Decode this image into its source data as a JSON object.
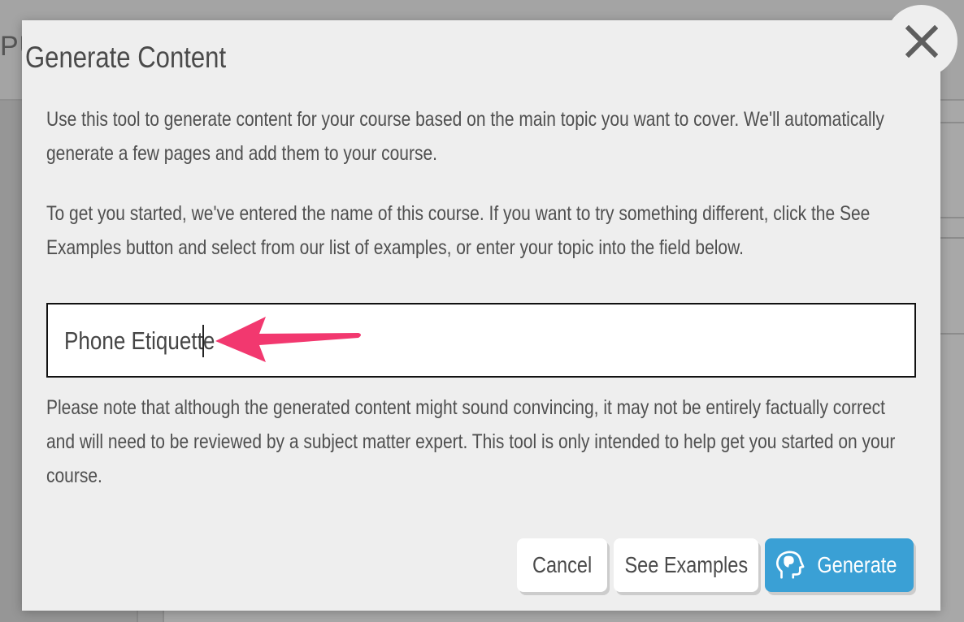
{
  "background": {
    "header_fragment": "PU"
  },
  "modal": {
    "title": "Generate Content",
    "close_icon": "close-icon",
    "paragraph_intro": "Use this tool to generate content for your course based on the main topic you want to cover. We'll automatically generate a few pages and add them to your course.",
    "paragraph_instructions": "To get you started, we've entered the name of this course. If you want to try something different, click the See Examples button and select from our list of examples, or enter your topic into the field below.",
    "topic_input": {
      "value": "Phone Etiquette",
      "annotation": "pink-arrow-icon"
    },
    "paragraph_disclaimer": "Please note that although the generated content might sound convincing, it may not be entirely factually correct and will need to be reviewed by a subject matter expert. This tool is only intended to help get you started on your course.",
    "buttons": {
      "cancel": "Cancel",
      "see_examples": "See Examples",
      "generate": "Generate",
      "generate_icon": "brain-head-icon"
    }
  },
  "colors": {
    "overlay": "#9b9b9b",
    "modal_bg": "#eeeeee",
    "primary": "#3aa0d5",
    "annotation_arrow": "#f2386f",
    "text": "#4f4f4f"
  }
}
